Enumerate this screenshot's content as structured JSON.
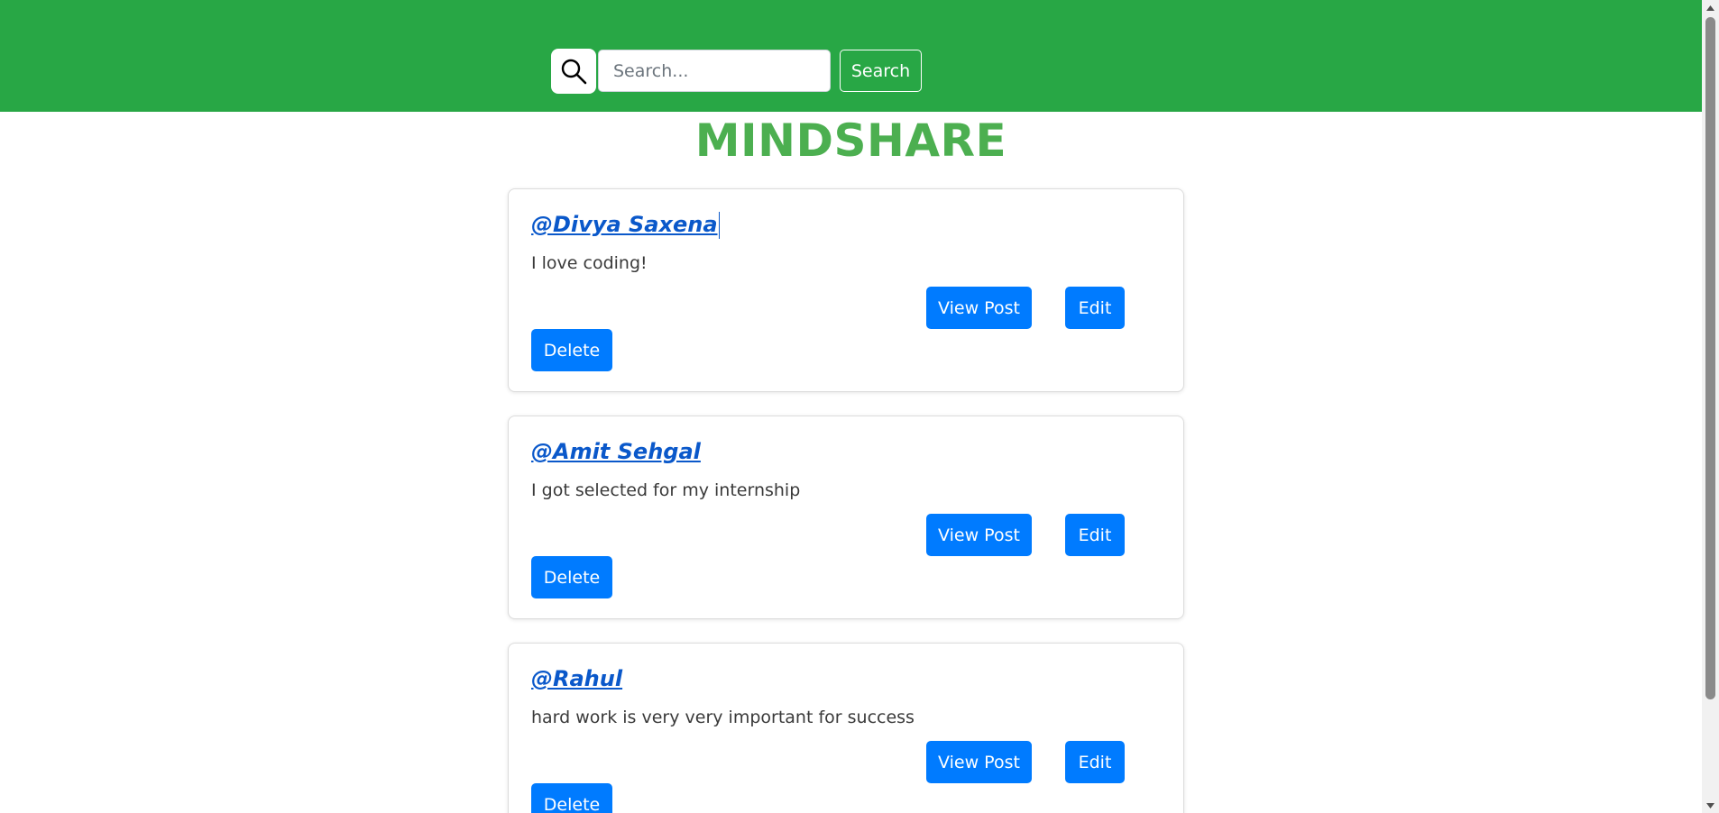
{
  "header": {
    "search_icon": "search-icon",
    "search_placeholder": "Search...",
    "search_value": "",
    "search_button_label": "Search",
    "color": "#28a745"
  },
  "brand": {
    "title": "MINDSHARE",
    "color": "#4caf50"
  },
  "posts": [
    {
      "author": "@Divya Saxena",
      "text": "I love coding!",
      "view_label": "View Post",
      "edit_label": "Edit",
      "delete_label": "Delete"
    },
    {
      "author": "@Amit Sehgal",
      "text": "I got selected for my internship",
      "view_label": "View Post",
      "edit_label": "Edit",
      "delete_label": "Delete"
    },
    {
      "author": "@Rahul",
      "text": "hard work is very very important for success",
      "view_label": "View Post",
      "edit_label": "Edit",
      "delete_label": "Delete"
    }
  ],
  "colors": {
    "button_primary": "#007bff",
    "author_link": "#0a58ca"
  }
}
